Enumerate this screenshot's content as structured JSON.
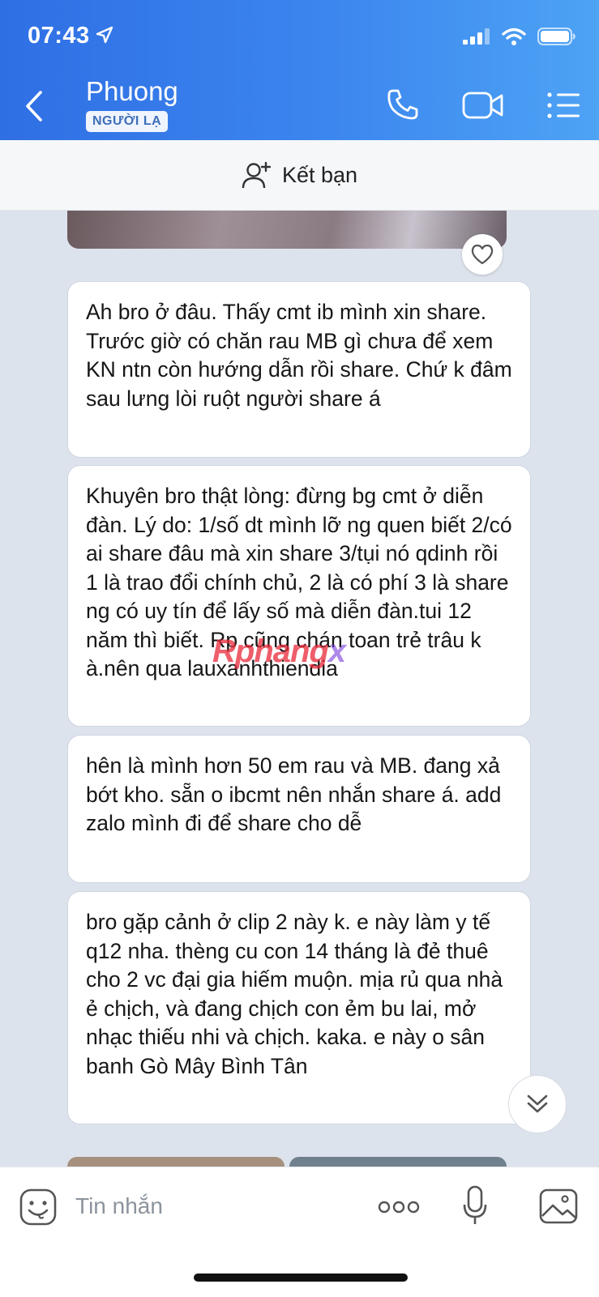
{
  "status_bar": {
    "time": "07:43"
  },
  "header": {
    "contact_name": "Phuong",
    "badge": "NGƯỜI LẠ"
  },
  "add_friend": {
    "label": "Kết bạn"
  },
  "messages": [
    {
      "text": "Ah bro ở đâu. Thấy cmt ib mình xin share. Trước giờ có chăn rau MB gì chưa để xem KN ntn còn hướng dẫn rồi share. Chứ k đâm sau lưng lòi ruột người share á"
    },
    {
      "text": "Khuyên bro thật lòng: đừng bg cmt ở diễn đàn. Lý do: 1/số dt mình lỡ ng quen biết 2/có ai share đâu mà xin share 3/tụi nó qdinh rồi 1 là trao đổi chính chủ, 2 là có phí 3 là share ng có uy tín để lấy số mà diễn đàn.tui 12 năm thì biết. Rp cũng chán toan trẻ trâu k à.nên qua lauxanhthiendia"
    },
    {
      "text": "hên là mình hơn 50 em rau và MB. đang xả bớt kho. sẵn o ibcmt nên nhắn share á. add zalo mình đi để share cho dễ"
    },
    {
      "text": "bro gặp cảnh ở clip 2 này k. e này làm y tế q12 nha. thèng cu con 14 tháng là đẻ thuê cho 2 vc đại gia hiếm muộn. mịa rủ qua nhà ẻ chịch, và đang chịch con ẻm bu lai, mở nhạc thiếu nhi và chịch. kaka. e này o sân banh Gò Mây Bình Tân"
    }
  ],
  "watermark": {
    "main": "Rphang",
    "accent": "x"
  },
  "composer": {
    "placeholder": "Tin nhắn"
  },
  "colors": {
    "header_start": "#2f6fe4",
    "header_end": "#4da3f4",
    "chat_bg": "#dde3ec"
  }
}
